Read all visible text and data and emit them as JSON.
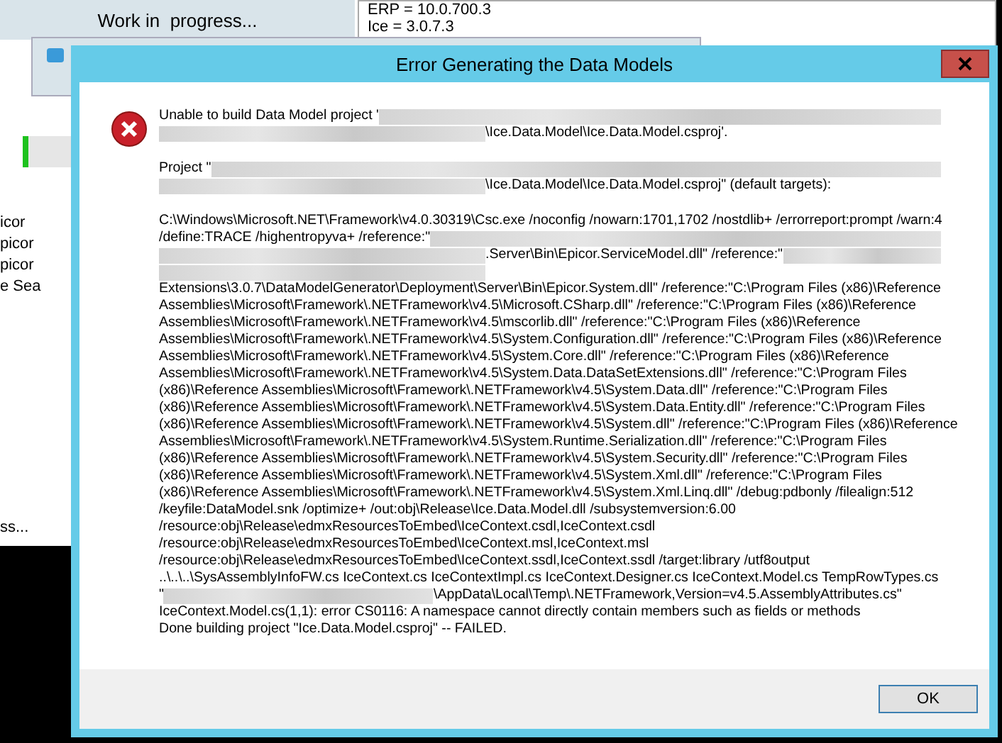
{
  "background_windows": {
    "progress_window": {
      "title": "Work in  progress...",
      "side_texts": [
        "icor",
        "picor",
        "picor",
        "e Sea"
      ],
      "footer_text": "ss...",
      "level": 0.02
    },
    "version_window": {
      "lines": [
        "ERP = 10.0.700.3",
        "Ice = 3.0.7.3"
      ]
    }
  },
  "dialog": {
    "title": "Error Generating the Data Models",
    "paragraphs": [
      [
        [
          {
            "kind": "text",
            "text": "Unable to build Data Model project '"
          },
          {
            "kind": "blurred"
          }
        ],
        [
          {
            "kind": "blurred"
          },
          {
            "kind": "text",
            "text": "\\Ice.Data.Model\\Ice.Data.Model.csproj'."
          }
        ]
      ],
      [
        [
          {
            "kind": "text",
            "text": "Project \""
          },
          {
            "kind": "blurred"
          }
        ],
        [
          {
            "kind": "blurred"
          },
          {
            "kind": "text",
            "text": "\\Ice.Data.Model\\Ice.Data.Model.csproj\" (default targets):"
          }
        ]
      ],
      [
        [
          {
            "kind": "text",
            "text": "C:\\Windows\\Microsoft.NET\\Framework\\v4.0.30319\\Csc.exe /noconfig /nowarn:1701,1702 /nostdlib+ /errorreport:prompt /warn:4"
          }
        ],
        [
          {
            "kind": "text",
            "text": "/define:TRACE /highentropyva+ /reference:\""
          },
          {
            "kind": "blurred"
          }
        ],
        [
          {
            "kind": "blurred"
          },
          {
            "kind": "text",
            "text": ".Server\\Bin\\Epicor.ServiceModel.dll\" /reference:\""
          },
          {
            "kind": "blurred"
          }
        ],
        [
          {
            "kind": "blurred"
          }
        ],
        [
          {
            "kind": "text",
            "text": "Extensions\\3.0.7\\DataModelGenerator\\Deployment\\Server\\Bin\\Epicor.System.dll\" /reference:\"C:\\Program Files (x86)\\Reference"
          }
        ],
        [
          {
            "kind": "text",
            "text": "Assemblies\\Microsoft\\Framework\\.NETFramework\\v4.5\\Microsoft.CSharp.dll\" /reference:\"C:\\Program Files (x86)\\Reference"
          }
        ],
        [
          {
            "kind": "text",
            "text": "Assemblies\\Microsoft\\Framework\\.NETFramework\\v4.5\\mscorlib.dll\" /reference:\"C:\\Program Files (x86)\\Reference"
          }
        ],
        [
          {
            "kind": "text",
            "text": "Assemblies\\Microsoft\\Framework\\.NETFramework\\v4.5\\System.Configuration.dll\" /reference:\"C:\\Program Files (x86)\\Reference"
          }
        ],
        [
          {
            "kind": "text",
            "text": "Assemblies\\Microsoft\\Framework\\.NETFramework\\v4.5\\System.Core.dll\" /reference:\"C:\\Program Files (x86)\\Reference"
          }
        ],
        [
          {
            "kind": "text",
            "text": "Assemblies\\Microsoft\\Framework\\.NETFramework\\v4.5\\System.Data.DataSetExtensions.dll\" /reference:\"C:\\Program Files"
          }
        ],
        [
          {
            "kind": "text",
            "text": "(x86)\\Reference Assemblies\\Microsoft\\Framework\\.NETFramework\\v4.5\\System.Data.dll\" /reference:\"C:\\Program Files"
          }
        ],
        [
          {
            "kind": "text",
            "text": "(x86)\\Reference Assemblies\\Microsoft\\Framework\\.NETFramework\\v4.5\\System.Data.Entity.dll\" /reference:\"C:\\Program Files"
          }
        ],
        [
          {
            "kind": "text",
            "text": "(x86)\\Reference Assemblies\\Microsoft\\Framework\\.NETFramework\\v4.5\\System.dll\" /reference:\"C:\\Program Files (x86)\\Reference"
          }
        ],
        [
          {
            "kind": "text",
            "text": "Assemblies\\Microsoft\\Framework\\.NETFramework\\v4.5\\System.Runtime.Serialization.dll\" /reference:\"C:\\Program Files"
          }
        ],
        [
          {
            "kind": "text",
            "text": "(x86)\\Reference Assemblies\\Microsoft\\Framework\\.NETFramework\\v4.5\\System.Security.dll\" /reference:\"C:\\Program Files"
          }
        ],
        [
          {
            "kind": "text",
            "text": "(x86)\\Reference Assemblies\\Microsoft\\Framework\\.NETFramework\\v4.5\\System.Xml.dll\" /reference:\"C:\\Program Files"
          }
        ],
        [
          {
            "kind": "text",
            "text": "(x86)\\Reference Assemblies\\Microsoft\\Framework\\.NETFramework\\v4.5\\System.Xml.Linq.dll\" /debug:pdbonly /filealign:512"
          }
        ],
        [
          {
            "kind": "text",
            "text": "/keyfile:DataModel.snk /optimize+ /out:obj\\Release\\Ice.Data.Model.dll /subsystemversion:6.00"
          }
        ],
        [
          {
            "kind": "text",
            "text": "/resource:obj\\Release\\edmxResourcesToEmbed\\IceContext.csdl,IceContext.csdl"
          }
        ],
        [
          {
            "kind": "text",
            "text": "/resource:obj\\Release\\edmxResourcesToEmbed\\IceContext.msl,IceContext.msl"
          }
        ],
        [
          {
            "kind": "text",
            "text": "/resource:obj\\Release\\edmxResourcesToEmbed\\IceContext.ssdl,IceContext.ssdl /target:library /utf8output"
          }
        ],
        [
          {
            "kind": "text",
            "text": "..\\..\\..\\SysAssemblyInfoFW.cs IceContext.cs IceContextImpl.cs IceContext.Designer.cs IceContext.Model.cs TempRowTypes.cs"
          }
        ],
        [
          {
            "kind": "text",
            "text": "\""
          },
          {
            "kind": "blurred"
          },
          {
            "kind": "text",
            "text": "\\AppData\\Local\\Temp\\.NETFramework,Version=v4.5.AssemblyAttributes.cs\""
          }
        ],
        [
          {
            "kind": "text",
            "text": "IceContext.Model.cs(1,1): error CS0116: A namespace cannot directly contain members such as fields or methods"
          }
        ],
        [
          {
            "kind": "text",
            "text": "Done building project \"Ice.Data.Model.csproj\" -- FAILED."
          }
        ]
      ]
    ],
    "buttons": [
      "OK"
    ]
  }
}
